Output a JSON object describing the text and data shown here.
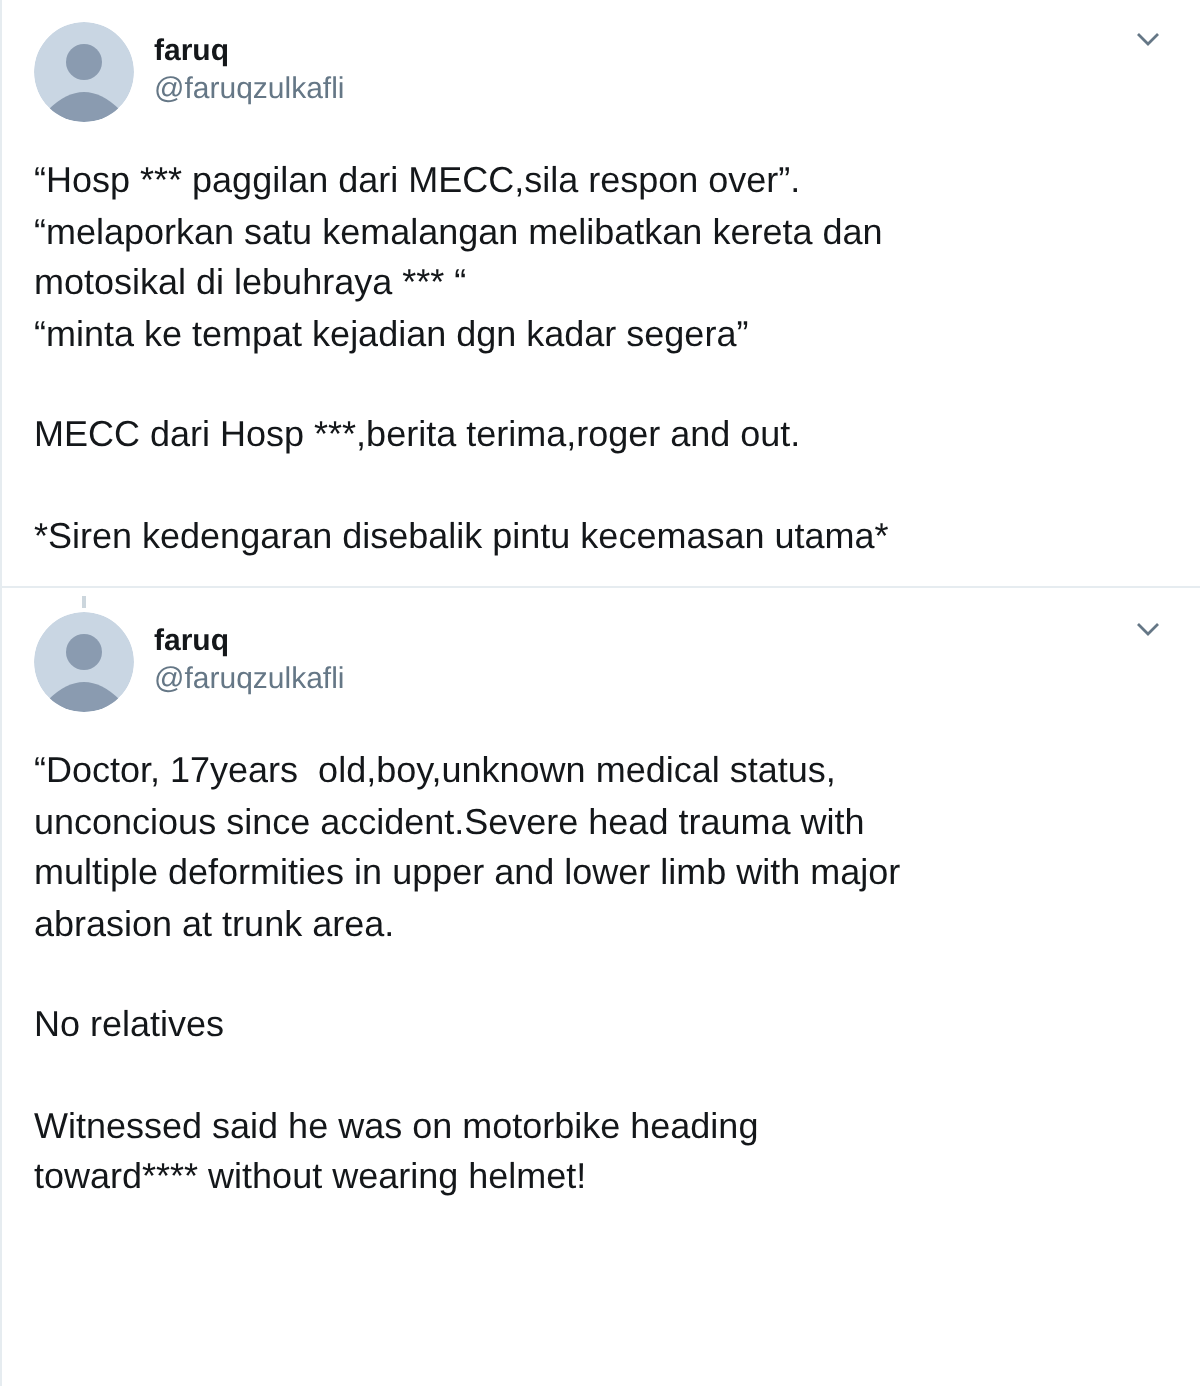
{
  "tweets": [
    {
      "name": "faruq",
      "handle": "@faruqzulkafli",
      "paragraphs": [
        "“Hosp *** paggilan dari MECC,sila respon over”.\n“melaporkan satu kemalangan melibatkan kereta dan\nmotosikal di lebuhraya *** “\n“minta ke tempat kejadian dgn kadar segera”",
        "MECC dari Hosp ***,berita terima,roger and out.",
        "*Siren kedengaran disebalik pintu kecemasan utama*"
      ]
    },
    {
      "name": "faruq",
      "handle": "@faruqzulkafli",
      "paragraphs": [
        "“Doctor, 17years  old,boy,unknown medical status,\nunconcious since accident.Severe head trauma with\nmultiple deformities in upper and lower limb with major\nabrasion at trunk area.",
        "No relatives",
        "Witnessed said he was on motorbike heading\ntoward**** without wearing helmet!"
      ]
    }
  ]
}
